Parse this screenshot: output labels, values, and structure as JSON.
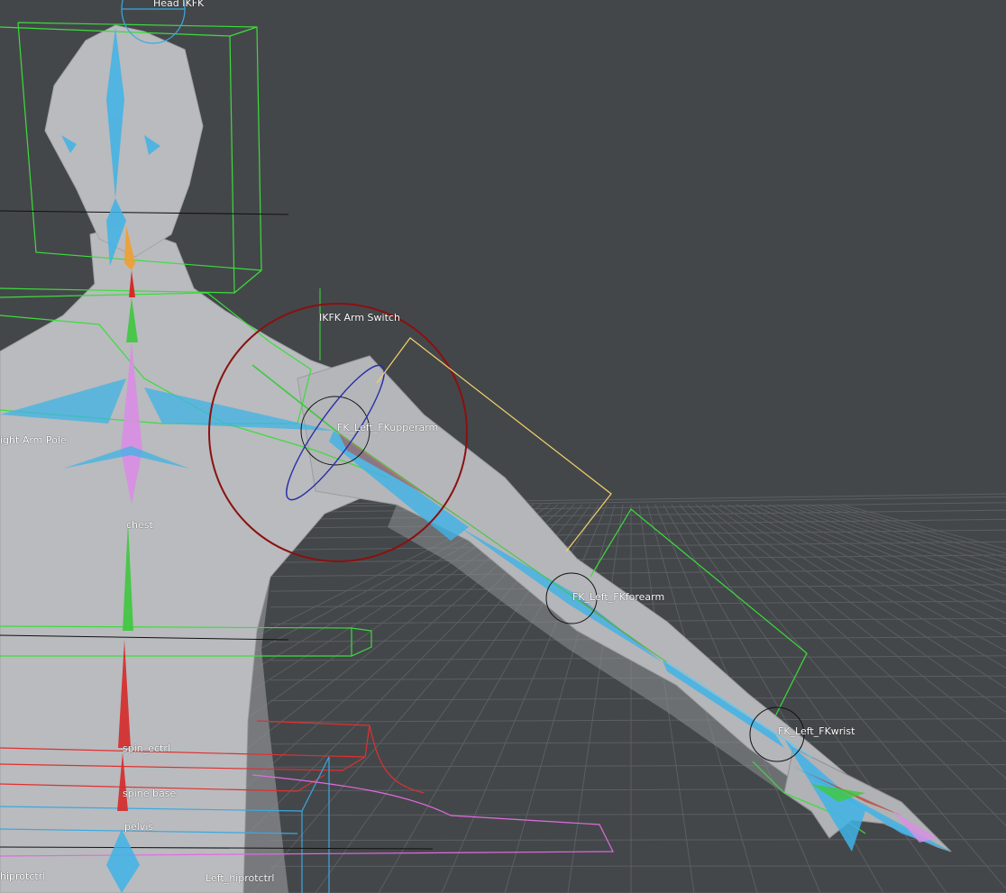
{
  "colors": {
    "background": "#44474a",
    "grid": "#5b5e62",
    "mesh": "#b9bbbe",
    "mesh_shade": "#8d8f93",
    "bone": "#3fb3e6",
    "spine_green": "#3ec83e",
    "spine_pink": "#d98ee3",
    "spine_red": "#d62a2a",
    "control_green": "#3cdc3c",
    "control_red": "#e03030",
    "control_blue": "#3aa8e0",
    "control_pink": "#e06be0",
    "switch_circle": "#8b1010",
    "pole_line": "#f5d36a",
    "label_text": "#ffffff"
  },
  "viewport": {
    "labels": {
      "head_ikfk": "Head IKFK",
      "ikfk_arm_switch": "IKFK Arm Switch",
      "fk_upperarm": "FK_Left_FKupperarm",
      "right_arm_pole": "ight Arm Pole",
      "chest": "chest",
      "fk_forearm": "FK_Left_FKforearm",
      "fk_wrist": "FK_Left_FKwrist",
      "spine_ctrl": "spin_ectrl",
      "spine_base": "spine base",
      "pelvis": "pelvis",
      "right_hip_ctrl": "hiprotctrl",
      "left_hip_ctrl": "Left_hiprotctrl"
    }
  }
}
